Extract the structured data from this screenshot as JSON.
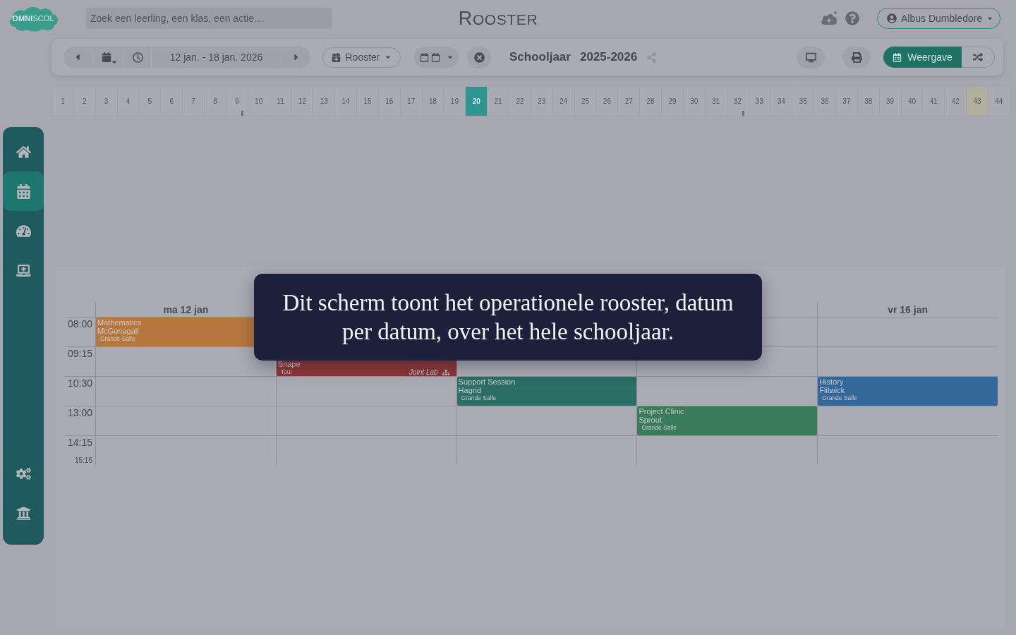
{
  "header": {
    "logo": "**OMNI**SCOL",
    "search": {
      "placeholder": "Zoek een leerling, een klas, een actie…"
    },
    "title": "ROOSTER",
    "user": "Albus Dumbledore"
  },
  "sidebar": {
    "items": [
      {
        "selected": false
      },
      {
        "selected": true
      },
      {
        "selected": false
      },
      {
        "selected": false
      }
    ],
    "bottom_items": [
      {
        "selected": false
      },
      {
        "selected": false
      }
    ]
  },
  "toolbar": {
    "date_range": "12 jan. - 18 jan. 2026",
    "schedule_menu": "Rooster",
    "school_year": {
      "label": "Schooljaar",
      "value": "2025-2026"
    },
    "view_button": "Weergave"
  },
  "weeks": [
    {
      "label": "1",
      "selected": false,
      "highlighted": false,
      "marked": false
    },
    {
      "label": "2",
      "selected": false,
      "highlighted": false,
      "marked": false
    },
    {
      "label": "3",
      "selected": false,
      "highlighted": false,
      "marked": false
    },
    {
      "label": "4",
      "selected": false,
      "highlighted": false,
      "marked": false
    },
    {
      "label": "5",
      "selected": false,
      "highlighted": false,
      "marked": false
    },
    {
      "label": "6",
      "selected": false,
      "highlighted": false,
      "marked": false
    },
    {
      "label": "7",
      "selected": false,
      "highlighted": false,
      "marked": false
    },
    {
      "label": "8",
      "selected": false,
      "highlighted": false,
      "marked": false
    },
    {
      "label": "9",
      "selected": false,
      "highlighted": false,
      "marked": true
    },
    {
      "label": "10",
      "selected": false,
      "highlighted": false,
      "marked": false
    },
    {
      "label": "11",
      "selected": false,
      "highlighted": false,
      "marked": false
    },
    {
      "label": "12",
      "selected": false,
      "highlighted": false,
      "marked": false
    },
    {
      "label": "13",
      "selected": false,
      "highlighted": false,
      "marked": false
    },
    {
      "label": "14",
      "selected": false,
      "highlighted": false,
      "marked": false
    },
    {
      "label": "15",
      "selected": false,
      "highlighted": false,
      "marked": false
    },
    {
      "label": "16",
      "selected": false,
      "highlighted": false,
      "marked": false
    },
    {
      "label": "17",
      "selected": false,
      "highlighted": false,
      "marked": false
    },
    {
      "label": "18",
      "selected": false,
      "highlighted": false,
      "marked": false
    },
    {
      "label": "19",
      "selected": false,
      "highlighted": false,
      "marked": false
    },
    {
      "label": "20",
      "selected": true,
      "highlighted": false,
      "marked": false
    },
    {
      "label": "21",
      "selected": false,
      "highlighted": false,
      "marked": false
    },
    {
      "label": "22",
      "selected": false,
      "highlighted": false,
      "marked": false
    },
    {
      "label": "23",
      "selected": false,
      "highlighted": false,
      "marked": false
    },
    {
      "label": "24",
      "selected": false,
      "highlighted": false,
      "marked": false
    },
    {
      "label": "25",
      "selected": false,
      "highlighted": false,
      "marked": false
    },
    {
      "label": "26",
      "selected": false,
      "highlighted": false,
      "marked": false
    },
    {
      "label": "27",
      "selected": false,
      "highlighted": false,
      "marked": false
    },
    {
      "label": "28",
      "selected": false,
      "highlighted": false,
      "marked": false
    },
    {
      "label": "29",
      "selected": false,
      "highlighted": false,
      "marked": false
    },
    {
      "label": "30",
      "selected": false,
      "highlighted": false,
      "marked": false
    },
    {
      "label": "31",
      "selected": false,
      "highlighted": false,
      "marked": false
    },
    {
      "label": "32",
      "selected": false,
      "highlighted": false,
      "marked": true
    },
    {
      "label": "33",
      "selected": false,
      "highlighted": false,
      "marked": false
    },
    {
      "label": "34",
      "selected": false,
      "highlighted": false,
      "marked": false
    },
    {
      "label": "35",
      "selected": false,
      "highlighted": false,
      "marked": false
    },
    {
      "label": "36",
      "selected": false,
      "highlighted": false,
      "marked": false
    },
    {
      "label": "37",
      "selected": false,
      "highlighted": false,
      "marked": false
    },
    {
      "label": "38",
      "selected": false,
      "highlighted": false,
      "marked": false
    },
    {
      "label": "39",
      "selected": false,
      "highlighted": false,
      "marked": false
    },
    {
      "label": "40",
      "selected": false,
      "highlighted": false,
      "marked": false
    },
    {
      "label": "41",
      "selected": false,
      "highlighted": false,
      "marked": false
    },
    {
      "label": "42",
      "selected": false,
      "highlighted": false,
      "marked": false
    },
    {
      "label": "43",
      "selected": false,
      "highlighted": true,
      "marked": false
    },
    {
      "label": "44",
      "selected": false,
      "highlighted": false,
      "marked": false
    }
  ],
  "calendar": {
    "header_cells": [
      {
        "kind": "label",
        "text": "ma 12 jan"
      },
      {
        "kind": "blank"
      },
      {
        "kind": "blank"
      },
      {
        "kind": "blank"
      },
      {
        "kind": "label",
        "text": "vr 16 jan"
      }
    ],
    "rows": [
      {
        "time": "08:00",
        "cells": [
          {
            "kind": "lesson",
            "color": "#b7783f",
            "subject": "Mathematics",
            "teacher": "McGonagall",
            "room": "Grande Salle"
          },
          {
            "kind": "blank"
          },
          {
            "kind": "blank"
          },
          {
            "kind": "blank"
          },
          {
            "kind": "blank"
          }
        ]
      },
      {
        "time": "09:15",
        "cells": [
          {
            "kind": "blank"
          },
          {
            "kind": "lesson",
            "color": "#8c3737",
            "teacher": "Snape",
            "room": "Tour",
            "tag": "Joint Lab"
          },
          {
            "kind": "blank"
          },
          {
            "kind": "blank"
          },
          {
            "kind": "blank"
          }
        ]
      },
      {
        "time": "10:30",
        "cells": [
          {
            "kind": "blank"
          },
          {
            "kind": "blank"
          },
          {
            "kind": "lesson",
            "color": "#2b6e66",
            "subject": "Support Session",
            "teacher": "Hagrid",
            "room": "Grande Salle"
          },
          {
            "kind": "blank"
          },
          {
            "kind": "lesson",
            "color": "#35689a",
            "subject": "History",
            "teacher": "Flitwick",
            "room": "Grande Salle"
          }
        ]
      },
      {
        "time": "13:00",
        "cells": [
          {
            "kind": "blank"
          },
          {
            "kind": "blank"
          },
          {
            "kind": "blank"
          },
          {
            "kind": "lesson",
            "color": "#3a7b5a",
            "subject": "Project Clinic",
            "teacher": "Sprout",
            "room": "Grande Salle"
          },
          {
            "kind": "blank"
          }
        ]
      },
      {
        "time": "14:15",
        "end": "15:15",
        "cells": [
          {
            "kind": "blank"
          },
          {
            "kind": "blank"
          },
          {
            "kind": "blank"
          },
          {
            "kind": "blank"
          },
          {
            "kind": "blank"
          }
        ]
      }
    ]
  },
  "tour_tooltip": {
    "text": "Dit scherm toont het operationele rooster, datum per datum, over het hele schooljaar."
  }
}
